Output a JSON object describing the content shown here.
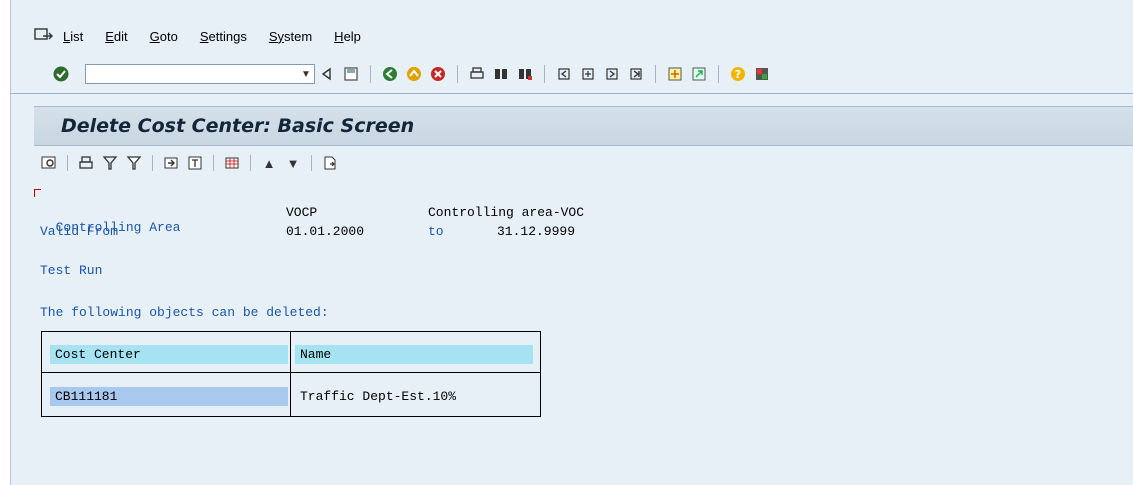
{
  "menu": {
    "items": [
      {
        "label": "List",
        "underline": "L",
        "rest": "ist"
      },
      {
        "label": "Edit",
        "underline": "E",
        "rest": "dit"
      },
      {
        "label": "Goto",
        "underline": "G",
        "rest": "oto"
      },
      {
        "label": "Settings",
        "underline": "S",
        "rest": "ettings"
      },
      {
        "label": "System",
        "underline": "Sy",
        "rest": "stem"
      },
      {
        "label": "Help",
        "underline": "H",
        "rest": "elp"
      }
    ]
  },
  "system_toolbar": {
    "command_value": "",
    "icons": [
      "enter-icon",
      "back-arrow-icon",
      "save-icon",
      "back-icon",
      "exit-icon",
      "cancel-icon",
      "print-icon",
      "find-icon",
      "find-next-icon",
      "first-page-icon",
      "previous-page-icon",
      "next-page-icon",
      "last-page-icon",
      "create-session-icon",
      "shortcut-icon",
      "help-icon",
      "layout-icon"
    ]
  },
  "title": "Delete Cost Center: Basic Screen",
  "app_toolbar": {
    "icons": [
      "details-icon",
      "print-icon",
      "filter-icon",
      "set-filter-icon",
      "export-icon",
      "local-file-icon",
      "column-icon",
      "sort-ascending-icon",
      "sort-descending-icon",
      "spreadsheet-icon"
    ]
  },
  "content": {
    "controlling_area_label": "Controlling Area",
    "controlling_area_value": "VOCP",
    "controlling_area_desc": "Controlling area-VOC",
    "valid_from_label": "Valid From",
    "valid_from_value": "01.01.2000",
    "to_label": "to",
    "valid_to_value": "31.12.9999",
    "test_run": "Test Run",
    "objects_heading": "The following objects can be deleted:",
    "table": {
      "headers": [
        "Cost Center",
        "Name"
      ],
      "rows": [
        [
          "CB111181",
          "Traffic Dept-Est.10%"
        ]
      ]
    }
  },
  "colors": {
    "background": "#e7f0f6",
    "label_blue": "#1a56a8",
    "header_cell": "#a6e3f2",
    "key_cell": "#a8c8ee"
  }
}
